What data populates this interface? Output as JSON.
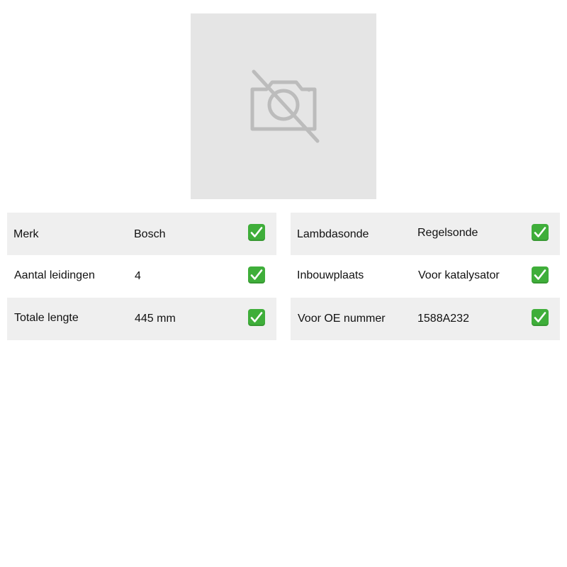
{
  "product_image": {
    "icon": "camera-off-icon",
    "background_color": "#e5e5e5"
  },
  "specs_left": [
    {
      "label": "Merk",
      "value": "Bosch",
      "icon": "check-mark-icon"
    },
    {
      "label": "Aantal leidingen",
      "value": "4",
      "icon": "check-mark-icon"
    },
    {
      "label": "Totale lengte",
      "value": "445 mm",
      "icon": "check-mark-icon"
    }
  ],
  "specs_right": [
    {
      "label": "Lambdasonde",
      "value": "Regelsonde",
      "icon": "check-mark-icon"
    },
    {
      "label": "Inbouwplaats",
      "value": "Voor katalysator",
      "icon": "check-mark-icon"
    },
    {
      "label": "Voor OE nummer",
      "value": "1588A232",
      "icon": "check-mark-icon"
    }
  ],
  "colors": {
    "row_shade": "#efefef",
    "check_green": "#3fae3a"
  }
}
